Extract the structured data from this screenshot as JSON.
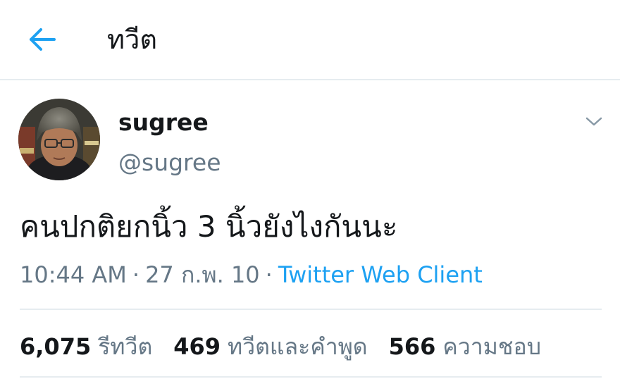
{
  "header": {
    "title": "ทวีต"
  },
  "tweet": {
    "display_name": "sugree",
    "handle": "@sugree",
    "text": "คนปกติยกนิ้ว 3 นิ้วยังไงกันนะ",
    "time": "10:44 AM",
    "date": "27 ก.พ. 10",
    "separator": "·",
    "client": "Twitter Web Client"
  },
  "stats": {
    "retweets_count": "6,075",
    "retweets_label": "รีทวีต",
    "quotes_count": "469",
    "quotes_label": "ทวีตและคำพูด",
    "likes_count": "566",
    "likes_label": "ความชอบ"
  },
  "colors": {
    "accent": "#1da1f2",
    "text_primary": "#14171a",
    "text_secondary": "#657786",
    "divider": "#e6ecf0"
  },
  "icons": {
    "back": "arrow-left-icon",
    "caret": "chevron-down-icon"
  }
}
